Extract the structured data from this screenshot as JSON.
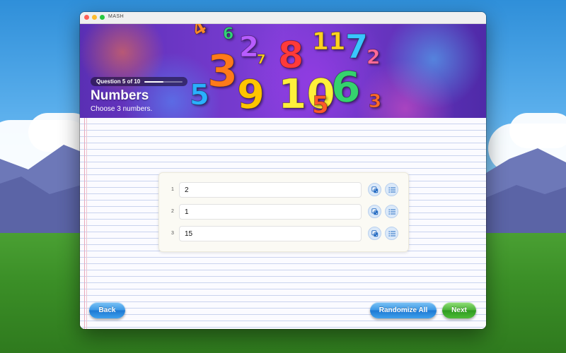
{
  "window": {
    "title": "MASH"
  },
  "header": {
    "progress_label": "Question 5 of 10",
    "progress_fraction": 0.5,
    "title": "Numbers",
    "subtitle": "Choose 3 numbers."
  },
  "entries": [
    {
      "index": "1",
      "value": "2"
    },
    {
      "index": "2",
      "value": "1"
    },
    {
      "index": "3",
      "value": "15"
    }
  ],
  "footer": {
    "back_label": "Back",
    "randomize_label": "Randomize All",
    "next_label": "Next"
  },
  "colors": {
    "accent_blue": "#3a96e6",
    "accent_green": "#49b236",
    "banner_purple": "#7e3ed6"
  }
}
